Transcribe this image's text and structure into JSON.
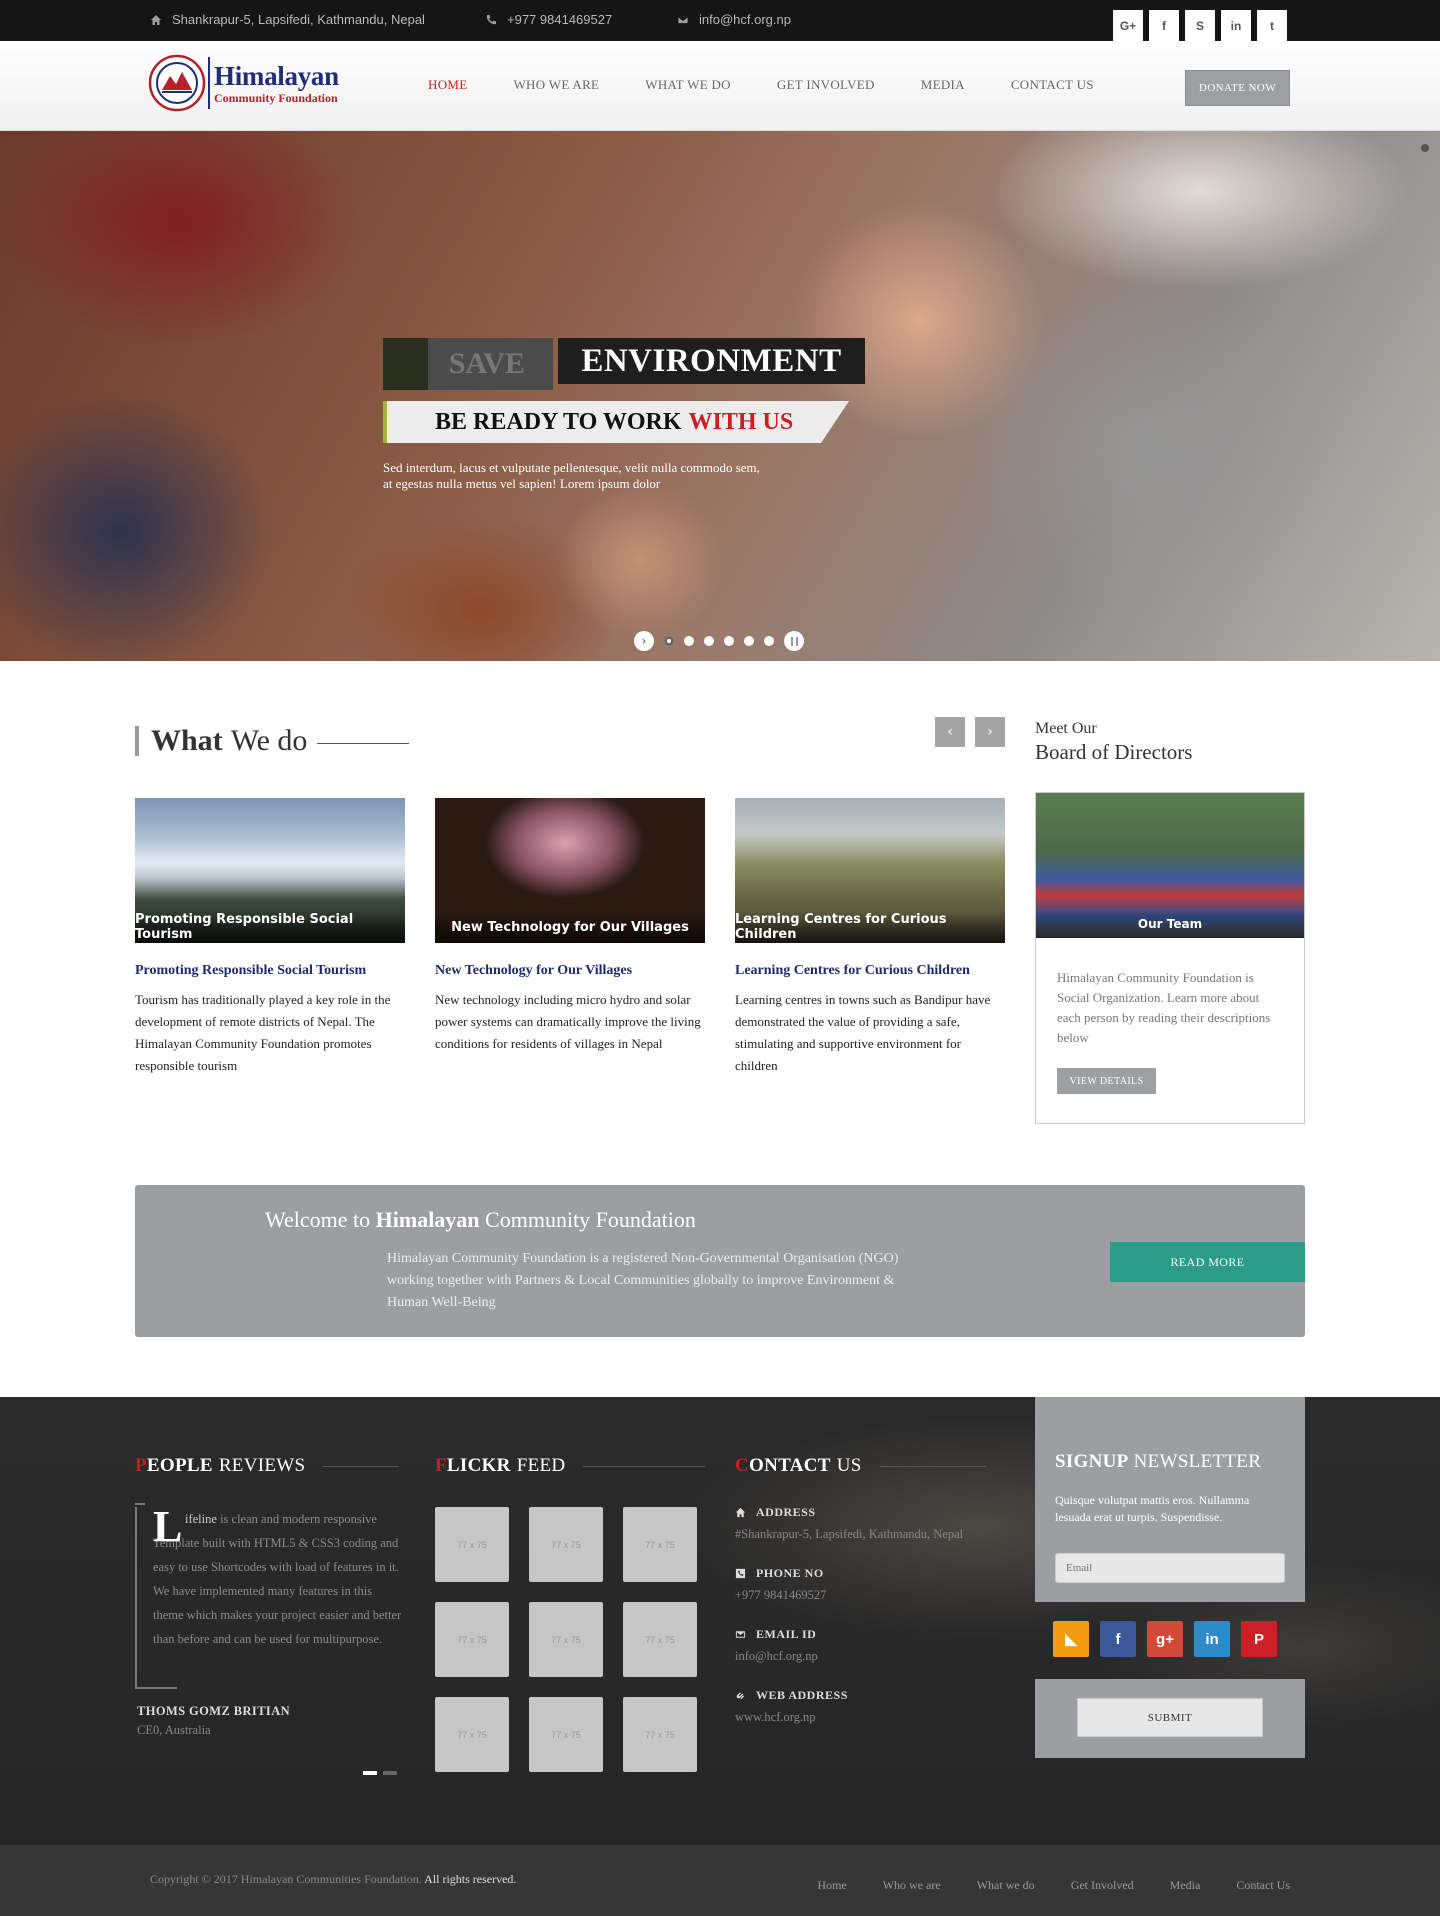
{
  "topbar": {
    "address": "Shankrapur-5, Lapsifedi, Kathmandu, Nepal",
    "phone": "+977 9841469527",
    "email": "info@hcf.org.np",
    "social": [
      "G+",
      "f",
      "S",
      "in",
      "t"
    ]
  },
  "logo": {
    "line1": "Himalayan",
    "line2": "Community Foundation"
  },
  "nav": {
    "items": [
      "HOME",
      "WHO WE ARE",
      "WHAT WE DO",
      "GET INVOLVED",
      "MEDIA",
      "CONTACT US"
    ],
    "donate": "DONATE NOW"
  },
  "hero": {
    "word1": "SAVE",
    "word2": "ENVIRONMENT",
    "tag_main": "BE READY TO WORK",
    "tag_red": "WITH US",
    "text": "Sed interdum, lacus et vulputate pellentesque, velit nulla commodo sem, at egestas nulla metus vel sapien! Lorem ipsum dolor"
  },
  "what_we_do": {
    "title_bold": "What",
    "title_rest": "We do",
    "cards": [
      {
        "overlay": "Promoting Responsible Social Tourism",
        "title": "Promoting Responsible Social Tourism",
        "text": "Tourism has traditionally played a key role in the development of remote districts of Nepal. The Himalayan Community Foundation promotes responsible tourism"
      },
      {
        "overlay": "New Technology for Our Villages",
        "title": "New Technology for Our Villages",
        "text": "New technology including micro hydro and solar power systems can dramatically improve the living conditions for residents of villages in Nepal"
      },
      {
        "overlay": "Learning Centres for Curious Children",
        "title": "Learning Centres for Curious Children",
        "text": "Learning centres in towns such as Bandipur have demonstrated the value of providing a safe, stimulating and supportive environment for children"
      }
    ]
  },
  "board": {
    "meet": "Meet Our",
    "title": "Board of Directors",
    "overlay": "Our Team",
    "text": "Himalayan Community Foundation is Social Organization. Learn more about each person by reading their descriptions below",
    "button": "VIEW DETAILS"
  },
  "welcome": {
    "pre": "Welcome to",
    "bold": "Himalayan",
    "post": "Community Foundation",
    "text": "Himalayan Community Foundation is a registered Non-Governmental Organisation (NGO) working together with Partners & Local Communities globally to improve Environment & Human Well-Being",
    "button": "READ MORE"
  },
  "reviews": {
    "t_first": "P",
    "t_bold": "EOPLE",
    "t_rest": "REVIEWS",
    "cap": "L",
    "lead": "ifeline",
    "text": "is clean and modern responsive Template built with HTML5 & CSS3 coding and easy to use Shortcodes with load of features in it. We have implemented many features in this theme which makes your project easier and better than before and can be used for multipurpose.",
    "name": "THOMS GOMZ BRITIAN",
    "role": "CE0, Australia"
  },
  "flickr": {
    "t_first": "F",
    "t_bold": "LICKR",
    "t_rest": "FEED",
    "thumbs": [
      "77 x 75",
      "77 x 75",
      "77 x 75",
      "77 x 75",
      "77 x 75",
      "77 x 75",
      "77 x 75",
      "77 x 75",
      "77 x 75"
    ]
  },
  "contact": {
    "t_first": "C",
    "t_bold": "ONTACT",
    "t_rest": "US",
    "address_label": "ADDRESS",
    "address": "#Shankrapur-5, Lapsifedi, Kathmandu, Nepal",
    "phone_label": "PHONE NO",
    "phone": "+977 9841469527",
    "email_label": "EMAIL ID",
    "email": "info@hcf.org.np",
    "web_label": "WEB ADDRESS",
    "web": "www.hcf.org.np"
  },
  "newsletter": {
    "t_bold": "SIGNUP",
    "t_rest": "NEWSLETTER",
    "text": "Quisque volutpat mattis eros. Nullamma lesuada erat ut turpis. Suspendisse.",
    "placeholder": "Email",
    "submit": "SUBMIT",
    "social": [
      {
        "icon": "rss-icon",
        "glyph": "◣",
        "color": "#f39c12"
      },
      {
        "icon": "facebook-icon",
        "glyph": "f",
        "color": "#3b5998"
      },
      {
        "icon": "google-plus-icon",
        "glyph": "g+",
        "color": "#d34836"
      },
      {
        "icon": "linkedin-icon",
        "glyph": "in",
        "color": "#2e8bc9"
      },
      {
        "icon": "pinterest-icon",
        "glyph": "P",
        "color": "#cb2027"
      }
    ]
  },
  "footer": {
    "copyright": "Copyright © 2017 Himalayan Communities Foundation.",
    "rights": "All rights reserved.",
    "links": [
      "Home",
      "Who we are",
      "What we do",
      "Get Involved",
      "Media",
      "Contact Us"
    ]
  }
}
